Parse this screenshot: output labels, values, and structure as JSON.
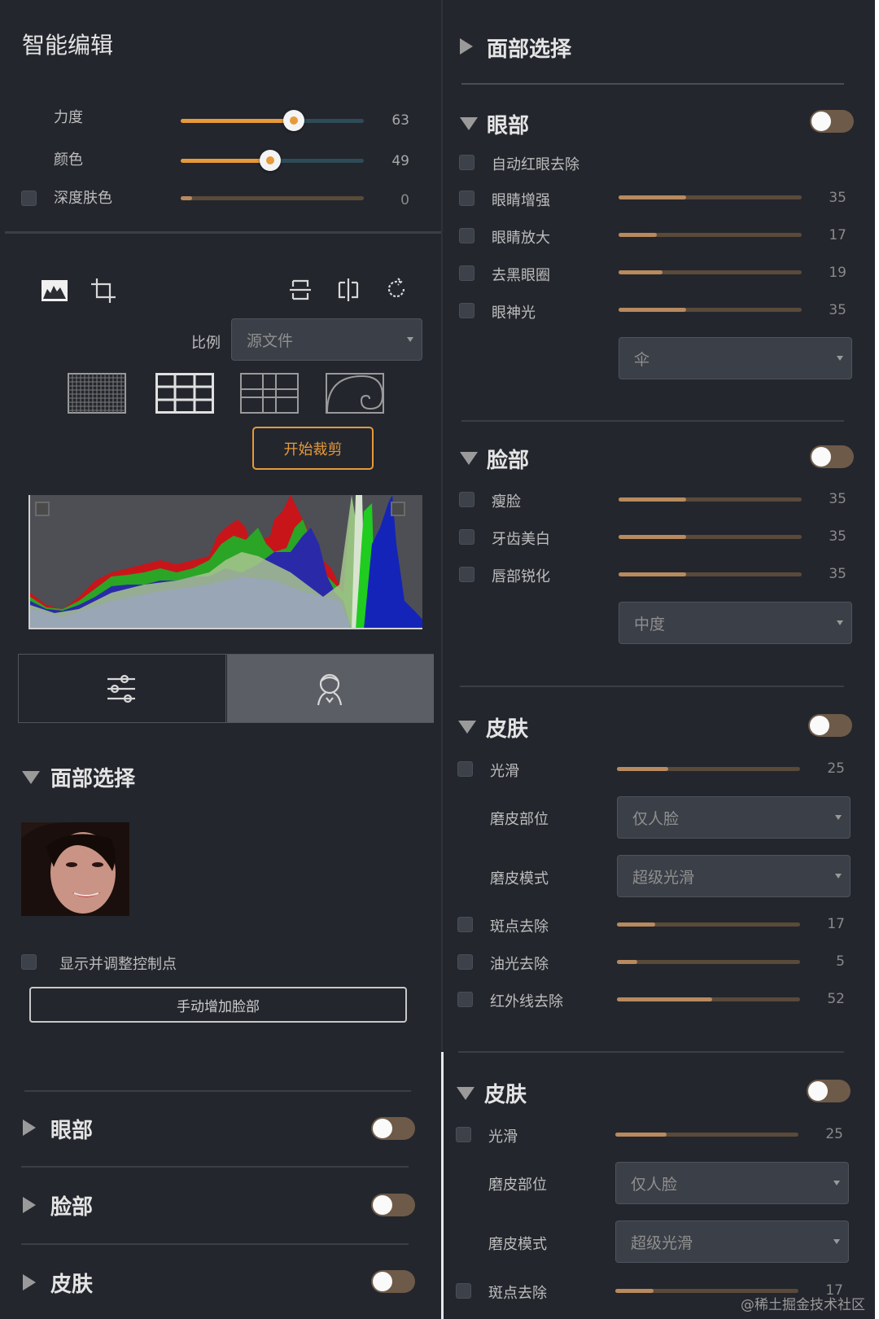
{
  "left": {
    "title": "智能编辑",
    "sliders": [
      {
        "label": "力度",
        "value": 63,
        "fraction": 0.62
      },
      {
        "label": "颜色",
        "value": 49,
        "fraction": 0.49
      },
      {
        "label": "深度肤色",
        "value": 0,
        "fraction": 0.05
      }
    ],
    "ratio_label": "比例",
    "ratio_value": "源文件",
    "start_crop": "开始裁剪",
    "face_section_title": "面部选择",
    "show_points_label": "显示并调整控制点",
    "manual_add_face": "手动增加脸部",
    "collapsed_sections": [
      "眼部",
      "脸部",
      "皮肤"
    ]
  },
  "right": {
    "face_select_title": "面部选择",
    "eyes": {
      "title": "眼部",
      "items": [
        {
          "label": "自动红眼去除",
          "has_slider": false
        },
        {
          "label": "眼睛增强",
          "value": 35,
          "fraction": 0.37
        },
        {
          "label": "眼睛放大",
          "value": 17,
          "fraction": 0.2
        },
        {
          "label": "去黑眼圈",
          "value": 19,
          "fraction": 0.23
        },
        {
          "label": "眼神光",
          "value": 35,
          "fraction": 0.37
        }
      ],
      "select_value": "伞"
    },
    "face": {
      "title": "脸部",
      "items": [
        {
          "label": "瘦脸",
          "value": 35,
          "fraction": 0.37
        },
        {
          "label": "牙齿美白",
          "value": 35,
          "fraction": 0.37
        },
        {
          "label": "唇部锐化",
          "value": 35,
          "fraction": 0.37
        }
      ],
      "select_value": "中度"
    },
    "skin": {
      "title": "皮肤",
      "smooth_label": "光滑",
      "smooth_value": 25,
      "smooth_fraction": 0.28,
      "area_label": "磨皮部位",
      "area_value": "仅人脸",
      "mode_label": "磨皮模式",
      "mode_value": "超级光滑",
      "items": [
        {
          "label": "斑点去除",
          "value": 17,
          "fraction": 0.2
        },
        {
          "label": "油光去除",
          "value": 5,
          "fraction": 0.1
        },
        {
          "label": "红外线去除",
          "value": 52,
          "fraction": 0.52
        }
      ]
    },
    "skin2": {
      "title": "皮肤",
      "smooth_label": "光滑",
      "smooth_value": 25,
      "area_label": "磨皮部位",
      "area_value": "仅人脸",
      "mode_label": "磨皮模式",
      "mode_value": "超级光滑",
      "spot_label": "斑点去除",
      "spot_value": 17
    }
  },
  "watermark": "@稀土掘金技术社区",
  "colors": {
    "accent": "#e69a3a",
    "slider_inactive": "#b88a5e",
    "panel": "#23262d"
  }
}
